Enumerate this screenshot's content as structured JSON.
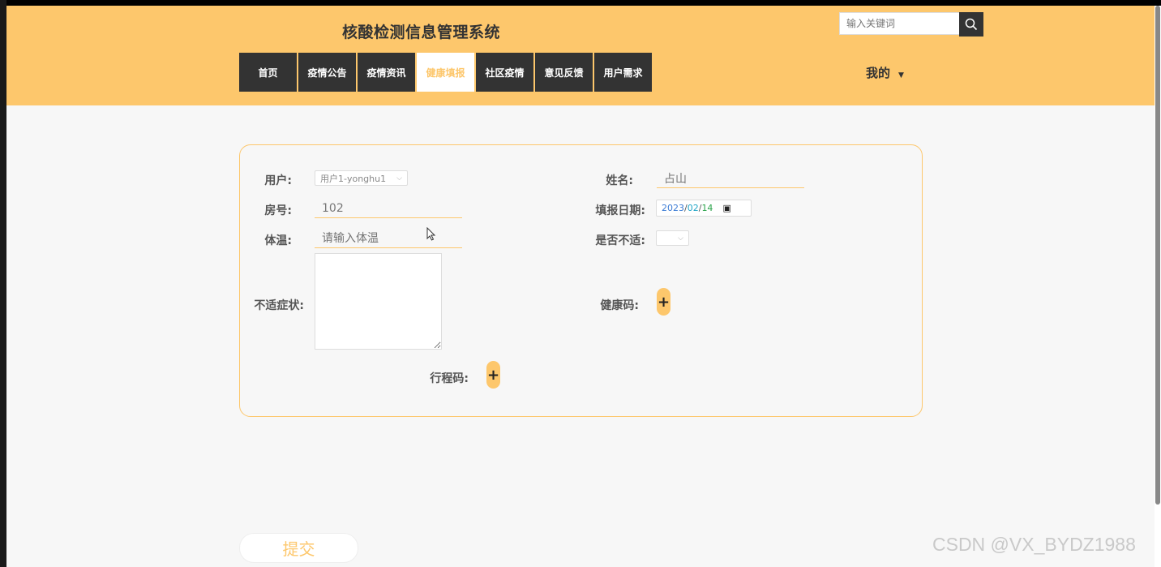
{
  "header": {
    "title": "核酸检测信息管理系统",
    "search_placeholder": "输入关键词",
    "user_menu_label": "我的",
    "accent_color": "#fdc76c"
  },
  "nav": {
    "items": [
      {
        "label": "首页",
        "active": false
      },
      {
        "label": "疫情公告",
        "active": false
      },
      {
        "label": "疫情资讯",
        "active": false
      },
      {
        "label": "健康填报",
        "active": true
      },
      {
        "label": "社区疫情",
        "active": false
      },
      {
        "label": "意见反馈",
        "active": false
      },
      {
        "label": "用户需求",
        "active": false
      }
    ]
  },
  "form": {
    "user_label": "用户:",
    "user_value": "用户1-yonghu1",
    "name_label": "姓名:",
    "name_value": "占山",
    "room_label": "房号:",
    "room_value": "102",
    "date_label": "填报日期:",
    "date_year": "2023",
    "date_month": "02",
    "date_day": "14",
    "temp_label": "体温:",
    "temp_placeholder": "请输入体温",
    "unwell_label": "是否不适:",
    "symptoms_label": "不适症状:",
    "health_code_label": "健康码:",
    "travel_code_label": "行程码:",
    "plus_symbol": "+",
    "submit_label": "提交"
  },
  "watermark": "CSDN @VX_BYDZ1988"
}
